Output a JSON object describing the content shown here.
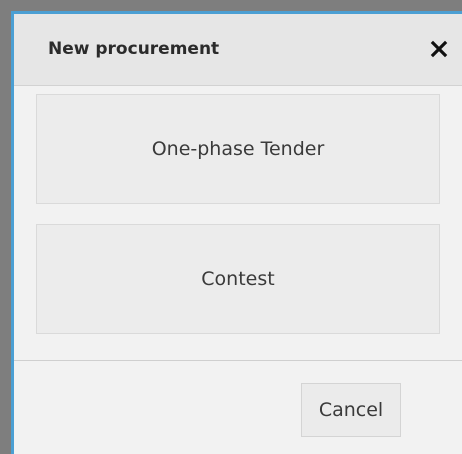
{
  "dialog": {
    "title": "New procurement",
    "close_icon": "close-icon",
    "options": [
      {
        "label": "One-phase Tender"
      },
      {
        "label": "Contest"
      }
    ],
    "cancel_label": "Cancel"
  },
  "colors": {
    "accent_border": "#4b9fd3",
    "backdrop": "#7e7e7e",
    "dialog_bg": "#f2f2f2",
    "header_bg": "#e6e6e6",
    "button_bg": "#ececec"
  }
}
